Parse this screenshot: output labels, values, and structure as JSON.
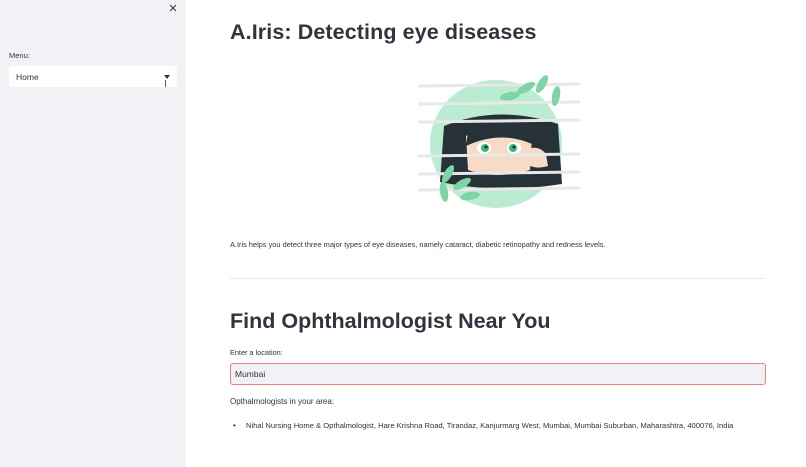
{
  "sidebar": {
    "close_label": "×",
    "menu_label": "Menu:",
    "menu_selected": "Home"
  },
  "main": {
    "title": "A.Iris: Detecting eye diseases",
    "illustration": "woman-peeking-through-blinds-with-leaves",
    "intro": "A.Iris helps you detect three major types of eye diseases, namely cataract, diabetic retinopathy and redness levels.",
    "finder": {
      "heading": "Find Ophthalmologist Near You",
      "input_label": "Enter a location:",
      "input_value": "Mumbai",
      "results_label": "Opthalmologists in your area:",
      "results": [
        "Nihal Nursing Home & Opthalmologist, Hare Krishna Road, Tirandaz, Kanjurmarg West, Mumbai, Mumbai Suburban, Maharashtra, 400076, India"
      ]
    }
  },
  "colors": {
    "sidebar_bg": "#f0f2f6",
    "text": "#31333f",
    "accent_green": "#8fe0b5",
    "input_focus_border": "#f08080"
  }
}
